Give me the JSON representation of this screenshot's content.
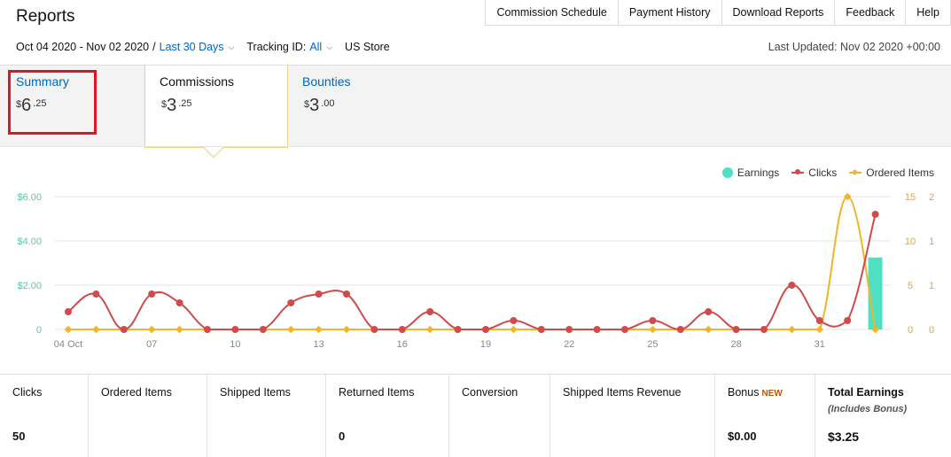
{
  "top_nav": {
    "items": [
      "Commission Schedule",
      "Payment History",
      "Download Reports",
      "Feedback",
      "Help"
    ]
  },
  "header": {
    "title": "Reports",
    "date_range": "Oct 04 2020 - Nov 02 2020",
    "separator": "/",
    "range_preset": "Last 30 Days",
    "tracking_label": "Tracking ID:",
    "tracking_value": "All",
    "store": "US Store",
    "last_updated": "Last Updated: Nov 02 2020 +00:00"
  },
  "tabs": [
    {
      "label": "Summary",
      "currency": "$",
      "dollars": "6",
      "cents": ".25"
    },
    {
      "label": "Commissions",
      "currency": "$",
      "dollars": "3",
      "cents": ".25"
    },
    {
      "label": "Bounties",
      "currency": "$",
      "dollars": "3",
      "cents": ".00"
    }
  ],
  "legend": {
    "earnings": "Earnings",
    "clicks": "Clicks",
    "ordered_items": "Ordered Items"
  },
  "colors": {
    "earnings": "#4fe0c3",
    "clicks": "#d04b4b",
    "ordered_items": "#f0b52a",
    "link": "#0066c0",
    "highlight": "#e1141f",
    "new_badge": "#c45500"
  },
  "chart_data": {
    "type": "line",
    "x_tick_labels": [
      "04 Oct",
      "07",
      "10",
      "13",
      "16",
      "19",
      "22",
      "25",
      "28",
      "31"
    ],
    "y_left_ticks": [
      "$6.00",
      "$4.00",
      "$2.00",
      "0"
    ],
    "y_right_clicks_ticks": [
      "15",
      "10",
      "5",
      "0"
    ],
    "y_right_items_ticks": [
      "2",
      "1",
      "1",
      "0"
    ],
    "ylim_earnings": [
      0,
      6
    ],
    "ylim_clicks": [
      0,
      15
    ],
    "ylim_items": [
      0,
      2
    ],
    "x": [
      "Oct 04",
      "Oct 05",
      "Oct 06",
      "Oct 07",
      "Oct 08",
      "Oct 09",
      "Oct 10",
      "Oct 11",
      "Oct 12",
      "Oct 13",
      "Oct 14",
      "Oct 15",
      "Oct 16",
      "Oct 17",
      "Oct 18",
      "Oct 19",
      "Oct 20",
      "Oct 21",
      "Oct 22",
      "Oct 23",
      "Oct 24",
      "Oct 25",
      "Oct 26",
      "Oct 27",
      "Oct 28",
      "Oct 29",
      "Oct 30",
      "Oct 31",
      "Nov 01",
      "Nov 02"
    ],
    "series": [
      {
        "name": "Clicks",
        "axis": "clicks",
        "values": [
          2,
          4,
          0,
          4,
          3,
          0,
          0,
          0,
          3,
          4,
          4,
          0,
          0,
          2,
          0,
          0,
          1,
          0,
          0,
          0,
          0,
          1,
          0,
          2,
          0,
          0,
          5,
          1,
          1,
          13
        ]
      },
      {
        "name": "Ordered Items",
        "axis": "items",
        "values": [
          0,
          0,
          0,
          0,
          0,
          0,
          0,
          0,
          0,
          0,
          0,
          0,
          0,
          0,
          0,
          0,
          0,
          0,
          0,
          0,
          0,
          0,
          0,
          0,
          0,
          0,
          0,
          0,
          2,
          0
        ]
      },
      {
        "name": "Earnings",
        "axis": "earnings",
        "type": "bar",
        "values": [
          0,
          0,
          0,
          0,
          0,
          0,
          0,
          0,
          0,
          0,
          0,
          0,
          0,
          0,
          0,
          0,
          0,
          0,
          0,
          0,
          0,
          0,
          0,
          0,
          0,
          0,
          0,
          0,
          0,
          3.25
        ]
      }
    ],
    "grid": true,
    "legend_position": "top-right"
  },
  "stats": [
    {
      "label": "Clicks",
      "value": "50"
    },
    {
      "label": "Ordered Items",
      "value": ""
    },
    {
      "label": "Shipped Items",
      "value": ""
    },
    {
      "label": "Returned Items",
      "value": "0"
    },
    {
      "label": "Conversion",
      "value": ""
    },
    {
      "label": "Shipped Items Revenue",
      "value": ""
    },
    {
      "label": "Bonus",
      "badge": "NEW",
      "value": "$0.00"
    },
    {
      "label": "Total Earnings",
      "sub": "(Includes Bonus)",
      "value": "$3.25"
    }
  ]
}
